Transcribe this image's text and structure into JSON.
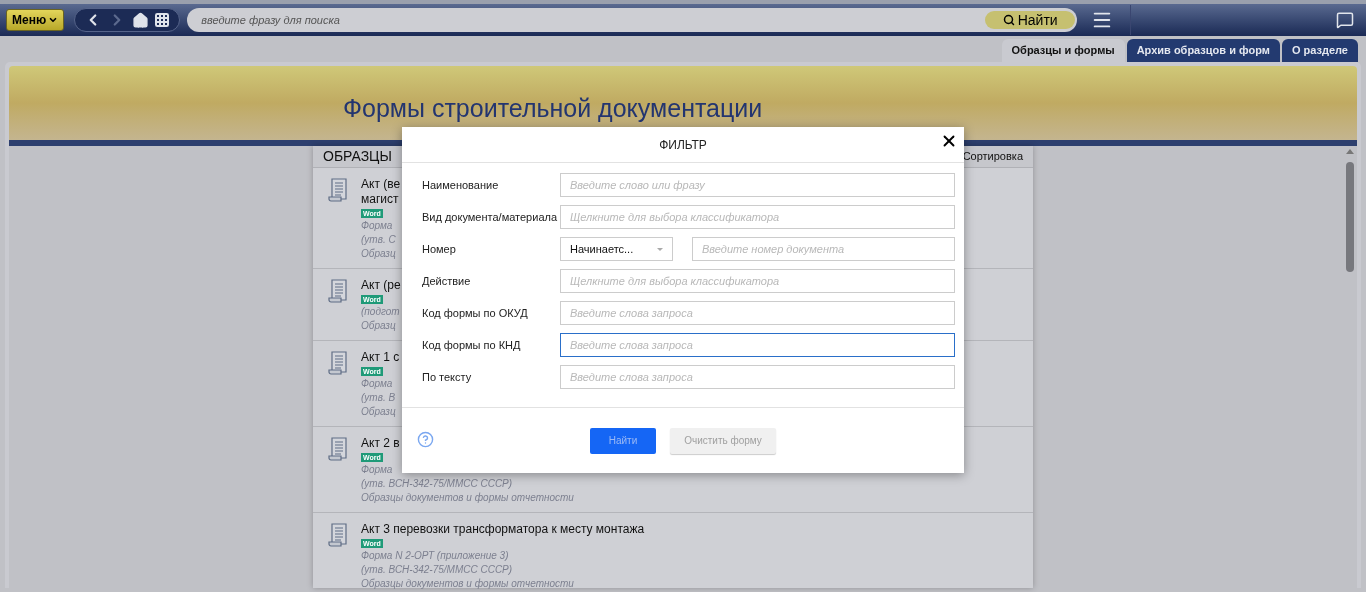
{
  "topbar": {
    "menu_button": "Меню",
    "search": {
      "placeholder": "введите фразу для поиска"
    },
    "search_button": "Найти"
  },
  "tabs": [
    {
      "label": "Образцы и формы",
      "selected": true
    },
    {
      "label": "Архив образцов и форм",
      "selected": false
    },
    {
      "label": "О разделе",
      "selected": false
    }
  ],
  "banner": {
    "title": "Формы строительной документации"
  },
  "list": {
    "heading": "ОБРАЗЦЫ",
    "sort_label": "Сортировка",
    "items": [
      {
        "title_lines": [
          "Акт (ве",
          "магист"
        ],
        "badge": "Word",
        "details": [
          "Форма",
          "(утв. С",
          "Образц"
        ]
      },
      {
        "title_lines": [
          "Акт (ре"
        ],
        "badge": "Word",
        "details": [
          "(подгот",
          "Образц"
        ]
      },
      {
        "title_lines": [
          "Акт 1 с"
        ],
        "badge": "Word",
        "details": [
          "Форма",
          "(утв. В",
          "Образц"
        ]
      },
      {
        "title_lines": [
          "Акт 2 в"
        ],
        "badge": "Word",
        "details": [
          "Форма",
          "(утв. ВСН-342-75/ММСС СССР)",
          "Образцы документов и формы отчетности"
        ]
      },
      {
        "title_lines": [
          "Акт 3 перевозки трансформатора к месту монтажа"
        ],
        "badge": "Word",
        "details": [
          "Форма N 2-ОРТ (приложение 3)",
          "(утв. ВСН-342-75/ММСС СССР)",
          "Образцы документов и формы отчетности"
        ]
      }
    ]
  },
  "dialog": {
    "title": "ФИЛЬТР",
    "fields": [
      {
        "kind": "text",
        "label": "Наименование",
        "placeholder": "Введите слово или фразу",
        "focused": false
      },
      {
        "kind": "text",
        "label": "Вид документа/материала",
        "placeholder": "Щелкните для выбора классификатора",
        "focused": false
      },
      {
        "kind": "number",
        "label": "Номер",
        "select_value": "Начинаетс...",
        "placeholder": "Введите номер документа",
        "focused": false
      },
      {
        "kind": "text",
        "label": "Действие",
        "placeholder": "Щелкните для выбора классификатора",
        "focused": false
      },
      {
        "kind": "text",
        "label": "Код формы по ОКУД",
        "placeholder": "Введите слова запроса",
        "focused": false
      },
      {
        "kind": "text",
        "label": "Код формы по КНД",
        "placeholder": "Введите слова запроса",
        "focused": true
      },
      {
        "kind": "text",
        "label": "По тексту",
        "placeholder": "Введите слова запроса",
        "focused": false
      }
    ],
    "buttons": [
      {
        "kind": "primary",
        "label": "Найти"
      },
      {
        "kind": "secondary",
        "label": "Очистить форму"
      }
    ]
  }
}
